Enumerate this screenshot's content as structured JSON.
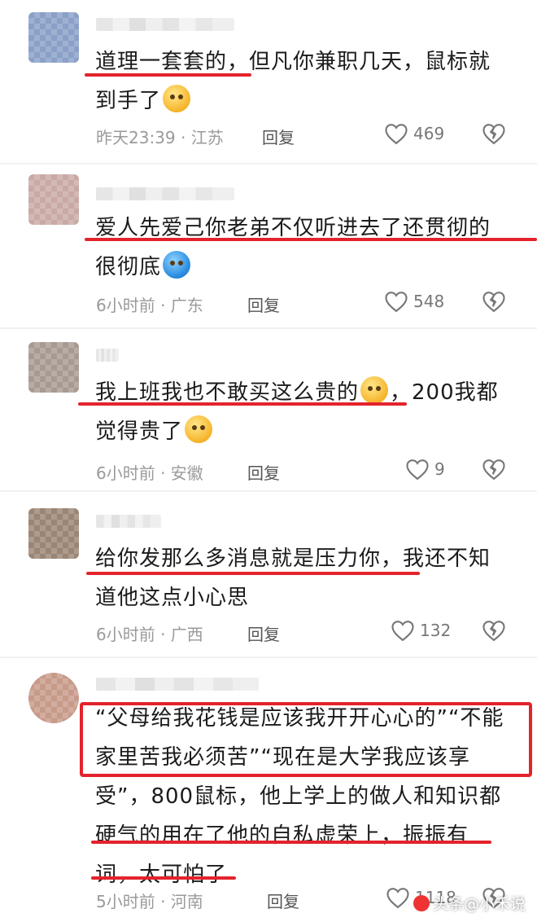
{
  "comments": [
    {
      "text": "道理一套套的，但凡你兼职几天，鼠标就到手了",
      "text_a": "道理一套套的，但凡你兼职几天，鼠标就",
      "text_b": "到手了",
      "emoji": "smirk-emoji",
      "time_location": "昨天23:39 · 江苏",
      "reply": "回复",
      "likes": "469"
    },
    {
      "text_a": "爱人先爱己你老弟不仅听进去了还贯彻的",
      "text_b": "很彻底",
      "emoji": "scared-emoji",
      "time_location": "6小时前 · 广东",
      "reply": "回复",
      "likes": "548"
    },
    {
      "text_a": "我上班我也不敢买这么贵的",
      "text_a2": "，200我都",
      "text_b": "觉得贵了",
      "emoji": "dizzy-emoji",
      "emoji2": "annoyed-emoji",
      "time_location": "6小时前 · 安徽",
      "reply": "回复",
      "likes": "9"
    },
    {
      "text_a": "给你发那么多消息就是压力你，我还不知",
      "text_b": "道他这点小心思",
      "time_location": "6小时前 · 广西",
      "reply": "回复",
      "likes": "132"
    },
    {
      "text_a": "“父母给我花钱是应该我开开心心的”“不能",
      "text_b": "家里苦我必须苦”“现在是大学我应该享",
      "text_c": "受”，800鼠标，他上学上的做人和知识都",
      "text_d": "硬气的用在了他的自私虚荣上，振振有",
      "text_e": "词，太可怕了",
      "time_location": "5小时前 · 河南",
      "reply": "回复",
      "likes": "1118"
    }
  ],
  "watermark": "头条@小禾说",
  "colors": {
    "highlight": "#e3232c",
    "meta": "#9a9a9a"
  }
}
